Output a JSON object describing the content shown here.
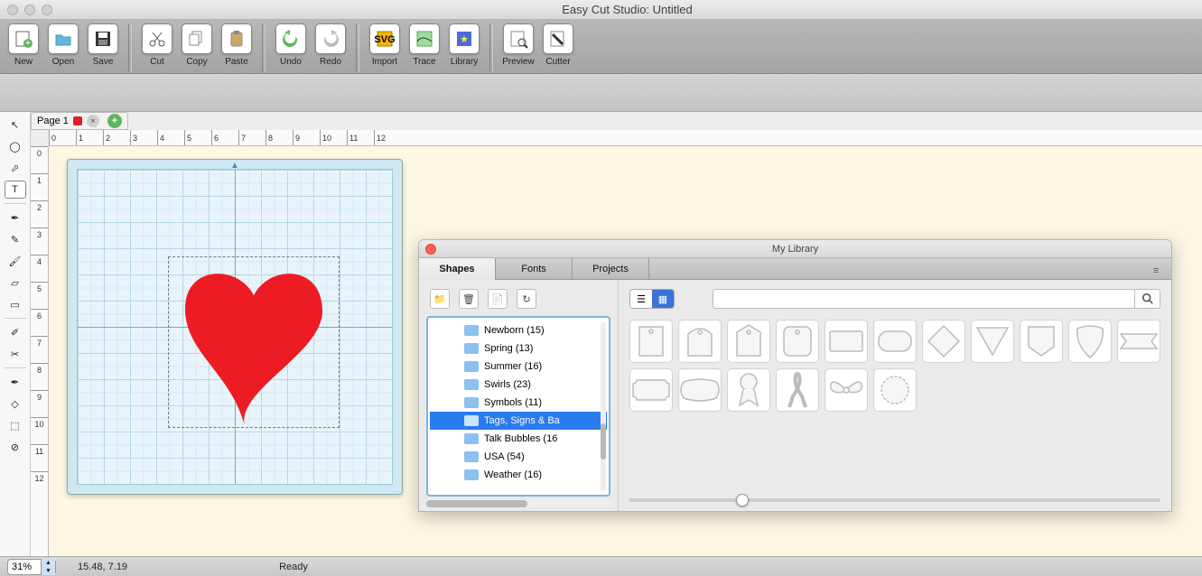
{
  "app": {
    "title": "Easy Cut Studio: Untitled"
  },
  "toolbar": {
    "items": [
      {
        "label": "New",
        "icon": "new"
      },
      {
        "label": "Open",
        "icon": "open"
      },
      {
        "label": "Save",
        "icon": "save"
      },
      {
        "sep": true
      },
      {
        "label": "Cut",
        "icon": "cut"
      },
      {
        "label": "Copy",
        "icon": "copy"
      },
      {
        "label": "Paste",
        "icon": "paste"
      },
      {
        "sep": true
      },
      {
        "label": "Undo",
        "icon": "undo"
      },
      {
        "label": "Redo",
        "icon": "redo"
      },
      {
        "sep": true
      },
      {
        "label": "Import",
        "icon": "import"
      },
      {
        "label": "Trace",
        "icon": "trace"
      },
      {
        "label": "Library",
        "icon": "library"
      },
      {
        "sep": true
      },
      {
        "label": "Preview",
        "icon": "preview"
      },
      {
        "label": "Cutter",
        "icon": "cutter"
      }
    ]
  },
  "page_tab": {
    "label": "Page 1"
  },
  "tool_palette": {
    "tools": [
      {
        "name": "arrow-icon",
        "glyph": "↖"
      },
      {
        "name": "lasso-icon",
        "glyph": "◯"
      },
      {
        "name": "node-arrow-icon",
        "glyph": "⬀"
      },
      {
        "name": "text-icon",
        "glyph": "T",
        "sel": true
      },
      {
        "sep": true
      },
      {
        "name": "pen-icon",
        "glyph": "✒"
      },
      {
        "name": "pencil-icon",
        "glyph": "✎"
      },
      {
        "name": "brush-icon",
        "glyph": "🖌"
      },
      {
        "name": "eraser-icon",
        "glyph": "▱"
      },
      {
        "name": "gradient-icon",
        "glyph": "▭"
      },
      {
        "sep": true
      },
      {
        "name": "eyedropper-icon",
        "glyph": "✐"
      },
      {
        "name": "knife-icon",
        "glyph": "✂"
      },
      {
        "sep": true
      },
      {
        "name": "fountain-icon",
        "glyph": "✒"
      },
      {
        "name": "shape-icon",
        "glyph": "◇"
      },
      {
        "name": "distort-icon",
        "glyph": "⬚"
      },
      {
        "name": "measure-icon",
        "glyph": "⊘"
      }
    ]
  },
  "ruler": {
    "h": [
      "0",
      "1",
      "2",
      "3",
      "4",
      "5",
      "6",
      "7",
      "8",
      "9",
      "10",
      "11",
      "12"
    ],
    "v": [
      "0",
      "1",
      "2",
      "3",
      "4",
      "5",
      "6",
      "7",
      "8",
      "9",
      "10",
      "11",
      "12"
    ]
  },
  "canvas": {
    "shape_color": "#ed1c24",
    "mat_hint": "▲"
  },
  "library": {
    "title": "My Library",
    "tabs": [
      {
        "label": "Shapes",
        "active": true
      },
      {
        "label": "Fonts",
        "active": false
      },
      {
        "label": "Projects",
        "active": false
      }
    ],
    "left_buttons": [
      "add-folder",
      "trash",
      "new-page",
      "refresh"
    ],
    "categories": [
      {
        "label": "Newborn (15)"
      },
      {
        "label": "Spring (13)"
      },
      {
        "label": "Summer (16)"
      },
      {
        "label": "Swirls (23)"
      },
      {
        "label": "Symbols (11)"
      },
      {
        "label": "Tags, Signs & Ba",
        "sel": true
      },
      {
        "label": "Talk Bubbles (16"
      },
      {
        "label": "USA (54)"
      },
      {
        "label": "Weather (16)"
      }
    ],
    "view_mode": "grid",
    "search_placeholder": "",
    "shapes": [
      "tag-rect",
      "tag-arch",
      "tag-pentagon",
      "tag-round",
      "label-rect",
      "label-round",
      "diamond",
      "triangle-down",
      "badge",
      "shield",
      "ribbon-banner",
      "plaque",
      "pillow",
      "award-ribbon",
      "awareness-ribbon",
      "bow",
      "seal"
    ]
  },
  "status": {
    "zoom": "31%",
    "coords": "15.48, 7.19",
    "state": "Ready"
  }
}
